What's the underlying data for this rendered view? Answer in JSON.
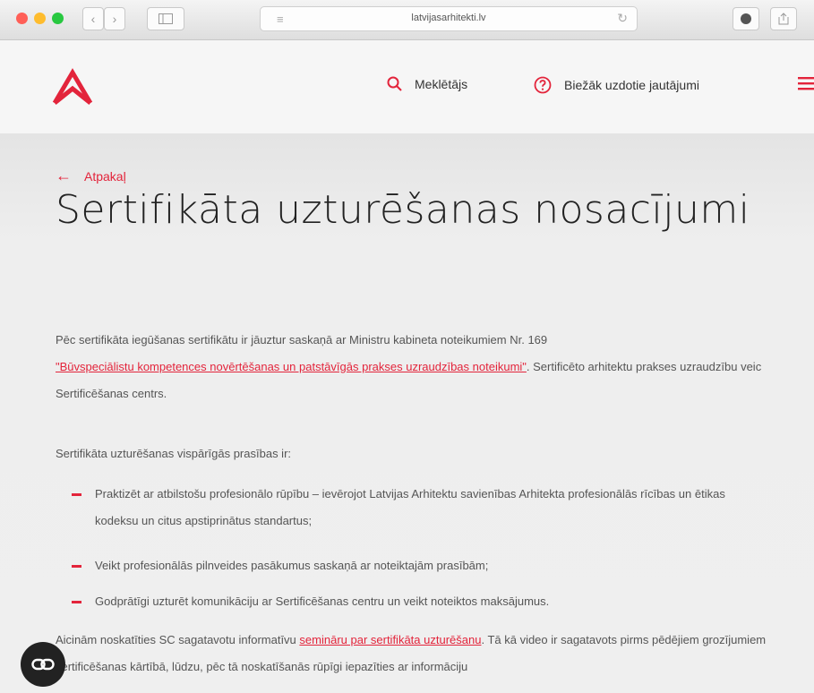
{
  "browser": {
    "url": "latvijasarhitekti.lv",
    "back_glyph": "‹",
    "forward_glyph": "›"
  },
  "header": {
    "logo_color": "#e3243b",
    "nav": [
      {
        "label": "Meklētājs",
        "icon": "search-icon"
      },
      {
        "label": "Biežāk uzdotie jautājumi",
        "icon": "question-icon"
      }
    ]
  },
  "page": {
    "back_label": "Atpakaļ",
    "title": "Sertifikāta uzturēšanas nosacījumi",
    "intro_before": "Pēc sertifikāta iegūšanas sertifikātu ir jāuztur saskaņā ar Ministru kabineta noteikumiem Nr. 169",
    "intro_link": "\"Būvspeciālistu kompetences novērtēšanas un patstāvīgās prakses uzraudzības noteikumi\"",
    "intro_after": ". Sertificēto arhitektu prakses uzraudzību veic Sertificēšanas centrs.",
    "requirements_heading": "Sertifikāta uzturēšanas vispārīgās prasības ir:",
    "requirements": [
      "Praktizēt ar atbilstošu profesionālo rūpību – ievērojot Latvijas Arhitektu savienības Arhitekta profesionālās rīcības un ētikas kodeksu un citus apstiprinātus standartus;",
      "Veikt profesionālās pilnveides pasākumus saskaņā ar noteiktajām prasībām;",
      "Godprātīgi uzturēt komunikāciju ar Sertificēšanas centru un veikt noteiktos maksājumus."
    ],
    "seminar_before": "Aicinām noskatīties SC sagatavotu informatīvu ",
    "seminar_link": "semināru par sertifikāta uzturēšanu",
    "seminar_after": ". Tā kā video ir sagatavots pirms pēdējiem grozījumiem sertificēšanas kārtībā, lūdzu, pēc tā noskatīšanās rūpīgi iepazīties ar informāciju"
  },
  "colors": {
    "accent": "#e3243b"
  }
}
